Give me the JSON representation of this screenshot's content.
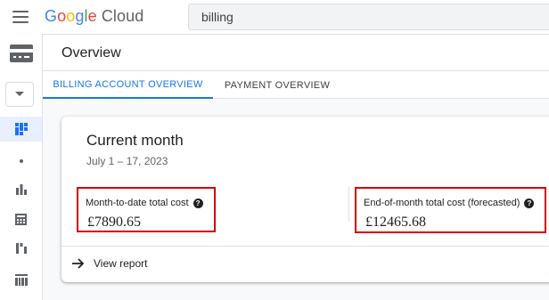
{
  "topbar": {
    "logo": {
      "google": "Google",
      "cloud": "Cloud"
    },
    "search": {
      "value": "billing"
    }
  },
  "sidebar": {
    "icons": [
      "billing-card-icon",
      "dropdown-arrow-icon",
      "dashboard-icon",
      "dot-icon",
      "bar-chart-icon",
      "calculator-icon",
      "waterfall-chart-icon",
      "table-chart-icon"
    ]
  },
  "header": {
    "title": "Overview"
  },
  "tabs": [
    {
      "label": "BILLING ACCOUNT OVERVIEW",
      "active": true
    },
    {
      "label": "PAYMENT OVERVIEW",
      "active": false
    }
  ],
  "card": {
    "title": "Current month",
    "date_range": "July 1 – 17, 2023",
    "month_to_date": {
      "label": "Month-to-date total cost",
      "value": "£7890.65"
    },
    "forecast": {
      "label": "End-of-month total cost (forecasted)",
      "value": "£12465.68"
    },
    "view_report": "View report"
  },
  "colors": {
    "accent": "#1a73e8",
    "highlight_border": "#d50000",
    "active_sidebar_bg": "#e8f0fe"
  }
}
